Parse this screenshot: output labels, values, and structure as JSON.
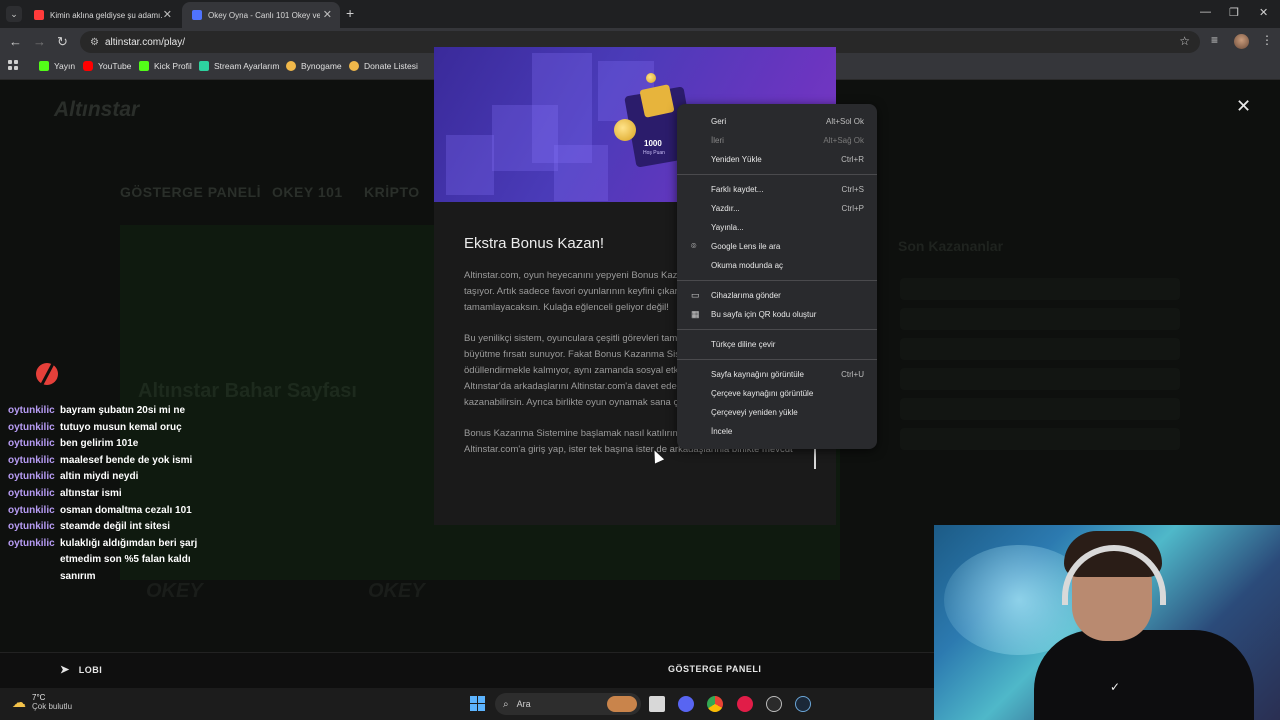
{
  "browser": {
    "tabs": [
      {
        "title": "Kimin aklına geldiyse şu adamı...",
        "active": false,
        "favicon_color": "#ff3b3b"
      },
      {
        "title": "Okey Oyna - Canlı 101 Okey ve ...",
        "active": true,
        "favicon_color": "#4f73ff"
      }
    ],
    "url": "altinstar.com/play/",
    "bookmarks": [
      {
        "label": "Yayın",
        "icon_color": "#53fc18"
      },
      {
        "label": "YouTube",
        "icon_color": "#ff0000"
      },
      {
        "label": "Kick Profil",
        "icon_color": "#53fc18"
      },
      {
        "label": "Stream Ayarlarım",
        "icon_color": "#2dd3a0"
      },
      {
        "label": "Bynogame",
        "icon_color": "#f0b84a"
      },
      {
        "label": "Donate Listesi",
        "icon_color": "#f0b84a"
      }
    ]
  },
  "site": {
    "modal": {
      "banner_amount": "1000",
      "banner_sub": "Hoş Puan",
      "title": "Ekstra Bonus Kazan!",
      "paragraphs": [
        "Altinstar.com, oyun heyecanını yepyeni Bonus Kazanma Sistemiyle zirvelere taşıyor. Artık sadece favori oyunlarının keyfini çıkarırken basit görevleri tamamlayacaksın. Kulağa eğlenceli geliyor değil!",
        "Bu yenilikçi sistem, oyunculara çeşitli görevleri tamamlayarak ücretsiz olarak büyütme fırsatı sunuyor. Fakat Bonus Kazanma Sistemi sadece bireysel çabaları ödüllendirmekle kalmıyor, aynı zamanda sosyal etkileşimi de teşvik ediyor. Altınstar'da arkadaşlarını Altinstar.com'a davet ederek ekstra bonuslar kazanabilirsin. Ayrıca birlikte oyun oynamak sana çok daha fazla ödül verebilir!",
        "Bonus Kazanma Sistemine başlamak nasıl katılırım diye merak mı ediyorsun? Altinstar.com'a giriş yap, ister tek başına ister de arkadaşlarınla birlikte mevcut"
      ]
    },
    "bottom_bar": {
      "lobby": "LOBI",
      "dashboard": "GÖSTERGE PANELI"
    }
  },
  "context_menu": {
    "groups": [
      [
        {
          "label": "Geri",
          "shortcut": "Alt+Sol Ok",
          "disabled": false
        },
        {
          "label": "İleri",
          "shortcut": "Alt+Sağ Ok",
          "disabled": true
        },
        {
          "label": "Yeniden Yükle",
          "shortcut": "Ctrl+R",
          "disabled": false
        }
      ],
      [
        {
          "label": "Farklı kaydet...",
          "shortcut": "Ctrl+S",
          "disabled": false
        },
        {
          "label": "Yazdır...",
          "shortcut": "Ctrl+P",
          "disabled": false
        },
        {
          "label": "Yayınla...",
          "shortcut": "",
          "disabled": false
        },
        {
          "label": "Google Lens ile ara",
          "shortcut": "",
          "disabled": false,
          "icon": "lens-icon"
        },
        {
          "label": "Okuma modunda aç",
          "shortcut": "",
          "disabled": false
        }
      ],
      [
        {
          "label": "Cihazlarıma gönder",
          "shortcut": "",
          "disabled": false,
          "icon": "devices-icon"
        },
        {
          "label": "Bu sayfa için QR kodu oluştur",
          "shortcut": "",
          "disabled": false,
          "icon": "qr-icon"
        }
      ],
      [
        {
          "label": "Türkçe diline çevir",
          "shortcut": "",
          "disabled": false
        }
      ],
      [
        {
          "label": "Sayfa kaynağını görüntüle",
          "shortcut": "Ctrl+U",
          "disabled": false
        },
        {
          "label": "Çerçeve kaynağını görüntüle",
          "shortcut": "",
          "disabled": false
        },
        {
          "label": "Çerçeveyi yeniden yükle",
          "shortcut": "",
          "disabled": false
        },
        {
          "label": "İncele",
          "shortcut": "",
          "disabled": false
        }
      ]
    ]
  },
  "chat": {
    "messages": [
      {
        "user": "oytunkilic",
        "text": "bayram şubatın 20si mi ne"
      },
      {
        "user": "oytunkilic",
        "text": "tutuyo musun kemal oruç"
      },
      {
        "user": "oytunkilic",
        "text": "ben gelirim 101e"
      },
      {
        "user": "oytunkilic",
        "text": "maalesef bende de yok ismi"
      },
      {
        "user": "oytunkilic",
        "text": "altin miydi neydi"
      },
      {
        "user": "oytunkilic",
        "text": "altınstar ismi"
      },
      {
        "user": "oytunkilic",
        "text": "osman domaltma cezalı 101"
      },
      {
        "user": "oytunkilic",
        "text": "steamde değil int sitesi"
      },
      {
        "user": "oytunkilic",
        "text": "kulaklığı aldığımdan beri şarj etmedim son %5 falan kaldı sanırım"
      }
    ]
  },
  "taskbar": {
    "weather_temp": "7°C",
    "weather_desc": "Çok bulutlu",
    "search_placeholder": "Ara"
  }
}
